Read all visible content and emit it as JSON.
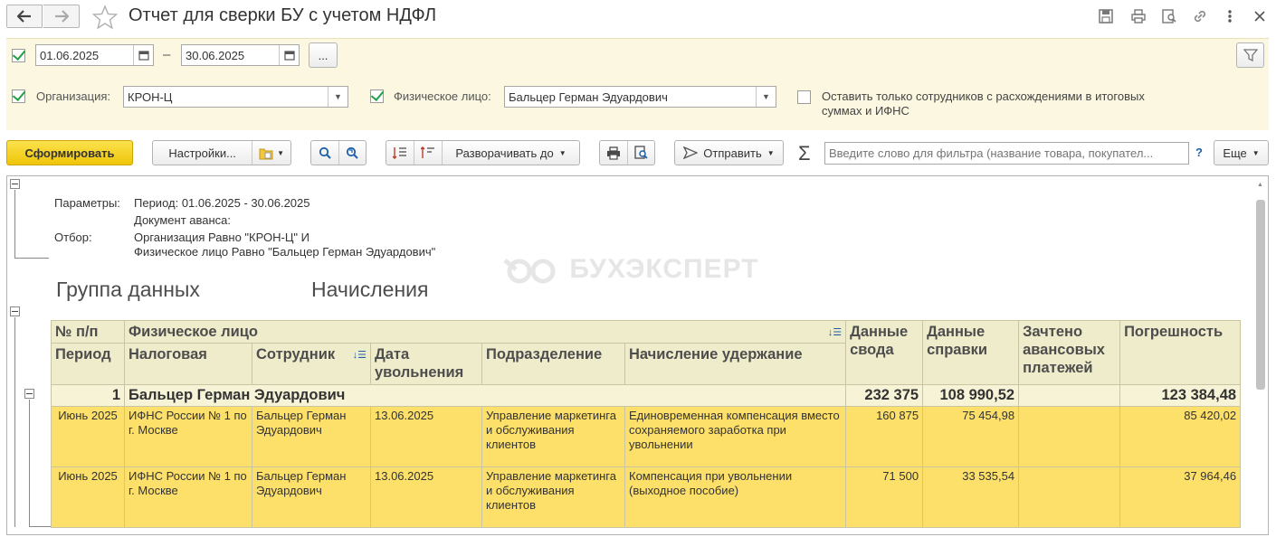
{
  "window": {
    "title": "Отчет для сверки БУ с учетом НДФЛ"
  },
  "period": {
    "from": "01.06.2025",
    "dash": "–",
    "to": "30.06.2025",
    "more_label": "..."
  },
  "filters": {
    "org_label": "Организация:",
    "org_value": "КРОН-Ц",
    "person_label": "Физическое лицо:",
    "person_value": "Бальцер Герман Эдуардович",
    "discrepancy_label_1": "Оставить только сотрудников с расхождениями в итоговых",
    "discrepancy_label_2": "суммах и ИФНС"
  },
  "toolbar": {
    "generate": "Сформировать",
    "settings": "Настройки...",
    "expand_to": "Разворачивать до",
    "send": "Отправить",
    "search_placeholder": "Введите слово для фильтра (название товара, покупател...",
    "help": "?",
    "more": "Еще"
  },
  "report": {
    "params_label": "Параметры:",
    "params_period": "Период: 01.06.2025 - 30.06.2025",
    "params_advance": "Документ аванса:",
    "filter_label": "Отбор:",
    "filter_line1": "Организация Равно \"КРОН-Ц\" И",
    "filter_line2": "Физическое лицо Равно \"Бальцер Герман Эдуардович\"",
    "watermark": "БУХЭКСПЕРТ",
    "group_data": "Группа данных",
    "accruals": "Начисления"
  },
  "table": {
    "headers": {
      "no": "№ п/п",
      "person": "Физическое лицо",
      "period": "Период",
      "tax": "Налоговая",
      "employee": "Сотрудник",
      "dismissal": "Дата увольнения",
      "division": "Подразделение",
      "accrual": "Начисление удержание",
      "summary": "Данные свода",
      "certificate": "Данные справки",
      "advance": "Зачтено авансовых платежей",
      "error": "Погрешность"
    },
    "group": {
      "no": "1",
      "name": "Бальцер Герман Эдуардович",
      "summary": "232 375",
      "certificate": "108 990,52",
      "advance": "",
      "error": "123 384,48"
    },
    "rows": [
      {
        "period": "Июнь 2025",
        "tax": "ИФНС России № 1 по г. Москве",
        "employee": "Бальцер Герман Эдуардович",
        "dismissal": "13.06.2025",
        "division": "Управление маркетинга и обслуживания клиентов",
        "accrual": "Единовременная компенсация вместо сохраняемого заработка при увольнении",
        "summary": "160 875",
        "certificate": "75 454,98",
        "advance": "",
        "error": "85 420,02"
      },
      {
        "period": "Июнь 2025",
        "tax": "ИФНС России № 1 по г. Москве",
        "employee": "Бальцер Герман Эдуардович",
        "dismissal": "13.06.2025",
        "division": "Управление маркетинга и обслуживания клиентов",
        "accrual": "Компенсация при увольнении (выходное пособие)",
        "summary": "71 500",
        "certificate": "33 535,54",
        "advance": "",
        "error": "37 964,46"
      }
    ]
  },
  "colors": {
    "accent": "#f0c50a",
    "params_bg": "#fbf7e0",
    "header_bg": "#efeccb",
    "row_bg": "#fde06a",
    "check": "#23a046"
  }
}
